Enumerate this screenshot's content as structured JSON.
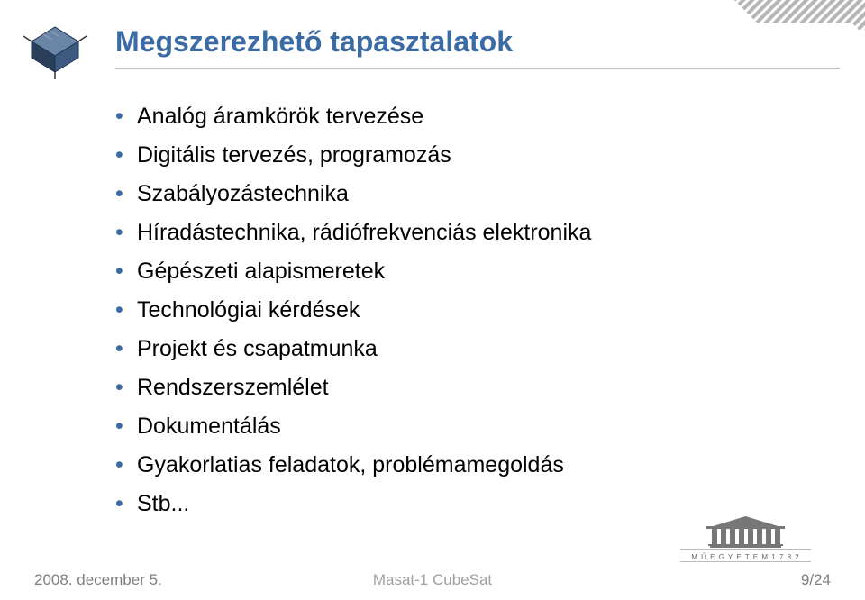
{
  "title": "Megszerezhető tapasztalatok",
  "bullets": [
    "Analóg áramkörök tervezése",
    "Digitális tervezés, programozás",
    "Szabályozástechnika",
    "Híradástechnika, rádiófrekvenciás elektronika",
    "Gépészeti alapismeretek",
    "Technológiai kérdések",
    "Projekt és csapatmunka",
    "Rendszerszemlélet",
    "Dokumentálás",
    "Gyakorlatias feladatok, problémamegoldás",
    "Stb..."
  ],
  "footer": {
    "date": "2008. december 5.",
    "center": "Masat-1 CubeSat",
    "page": "9/24"
  },
  "uni_logo_text": {
    "top": "M Ű E G Y E T E M   1 7 8 2"
  }
}
